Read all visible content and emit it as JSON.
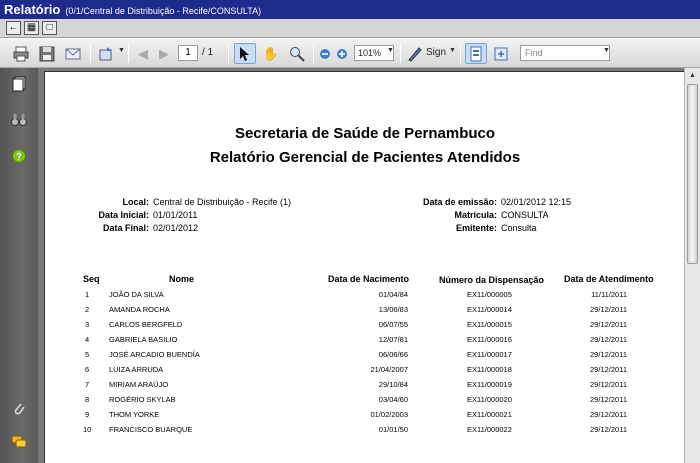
{
  "window": {
    "title": "Relatório",
    "subtitle": "(0/1/Central de Distribuição - Recife/CONSULTA)"
  },
  "toolbar": {
    "page_current": "1",
    "page_total": "/ 1",
    "zoom": "101%",
    "sign_label": "Sign",
    "find_placeholder": "Find"
  },
  "report": {
    "title_line1": "Secretaria de Saúde de Pernambuco",
    "title_line2": "Relatório Gerencial de Pacientes Atendidos",
    "fields_left": [
      {
        "label": "Local:",
        "value": "Central de Distribuição -  Recife (1)"
      },
      {
        "label": "Data Inicial:",
        "value": "01/01/2011"
      },
      {
        "label": "Data Final:",
        "value": "02/01/2012"
      }
    ],
    "fields_right": [
      {
        "label": "Data de emissão:",
        "value": "02/01/2012 12:15"
      },
      {
        "label": "Matrícula:",
        "value": "CONSULTA"
      },
      {
        "label": "Emitente:",
        "value": "Consulta"
      }
    ],
    "columns": [
      "Seq",
      "Nome",
      "Data de Nacimento",
      "Número da Dispensação",
      "Data de Atendimento"
    ],
    "rows": [
      {
        "seq": "1",
        "nome": "JOÃO DA SILVA",
        "nasc": "01/04/84",
        "disp": "EX11/000005",
        "atend": "11/11/2011"
      },
      {
        "seq": "2",
        "nome": "AMANDA ROCHA",
        "nasc": "13/06/83",
        "disp": "EX11/000014",
        "atend": "29/12/2011"
      },
      {
        "seq": "3",
        "nome": "CARLOS BERGFELD",
        "nasc": "06/07/55",
        "disp": "EX11/000015",
        "atend": "29/12/2011"
      },
      {
        "seq": "4",
        "nome": "GABRIELA BASILIO",
        "nasc": "12/07/81",
        "disp": "EX11/000016",
        "atend": "29/12/2011"
      },
      {
        "seq": "5",
        "nome": "JOSÉ ARCADIO BUENDÍA",
        "nasc": "06/06/66",
        "disp": "EX11/000017",
        "atend": "29/12/2011"
      },
      {
        "seq": "6",
        "nome": "LUIZA ARRUDA",
        "nasc": "21/04/2007",
        "disp": "EX11/000018",
        "atend": "29/12/2011"
      },
      {
        "seq": "7",
        "nome": "MIRIAM ARAÚJO",
        "nasc": "29/10/84",
        "disp": "EX11/000019",
        "atend": "29/12/2011"
      },
      {
        "seq": "8",
        "nome": "ROGÉRIO SKYLAB",
        "nasc": "03/04/60",
        "disp": "EX11/000020",
        "atend": "29/12/2011"
      },
      {
        "seq": "9",
        "nome": "THOM YORKE",
        "nasc": "01/02/2003",
        "disp": "EX11/000021",
        "atend": "29/12/2011"
      },
      {
        "seq": "10",
        "nome": "FRANCISCO BUARQUE",
        "nasc": "01/01/50",
        "disp": "EX11/000022",
        "atend": "29/12/2011"
      }
    ]
  },
  "colors": {
    "titlebar": "#1e2a8c",
    "sidebar": "#5f5f5f",
    "help_icon": "#7fc31c",
    "comment_icon": "#f2b21b"
  }
}
